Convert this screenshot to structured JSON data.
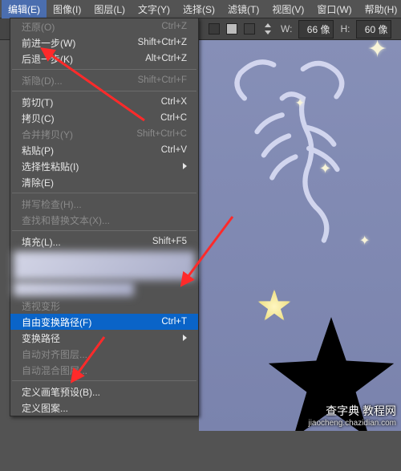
{
  "menubar": {
    "items": [
      {
        "label": "编辑(E)",
        "open": true
      },
      {
        "label": "图像(I)"
      },
      {
        "label": "图层(L)"
      },
      {
        "label": "文字(Y)"
      },
      {
        "label": "选择(S)"
      },
      {
        "label": "滤镜(T)"
      },
      {
        "label": "视图(V)"
      },
      {
        "label": "窗口(W)"
      },
      {
        "label": "帮助(H)"
      }
    ]
  },
  "edit_menu": {
    "undo": {
      "label": "还原(O)",
      "shortcut": "Ctrl+Z",
      "enabled": false
    },
    "step_fwd": {
      "label": "前进一步(W)",
      "shortcut": "Shift+Ctrl+Z",
      "enabled": true
    },
    "step_back": {
      "label": "后退一步(K)",
      "shortcut": "Alt+Ctrl+Z",
      "enabled": true
    },
    "fade": {
      "label": "渐隐(D)...",
      "shortcut": "Shift+Ctrl+F",
      "enabled": false
    },
    "cut": {
      "label": "剪切(T)",
      "shortcut": "Ctrl+X",
      "enabled": true
    },
    "copy": {
      "label": "拷贝(C)",
      "shortcut": "Ctrl+C",
      "enabled": true
    },
    "copy_merged": {
      "label": "合并拷贝(Y)",
      "shortcut": "Shift+Ctrl+C",
      "enabled": false
    },
    "paste": {
      "label": "粘贴(P)",
      "shortcut": "Ctrl+V",
      "enabled": true
    },
    "paste_sp": {
      "label": "选择性粘贴(I)",
      "shortcut": "",
      "enabled": true,
      "submenu": true
    },
    "clear": {
      "label": "清除(E)",
      "shortcut": "",
      "enabled": true
    },
    "spell": {
      "label": "拼写检查(H)...",
      "shortcut": "",
      "enabled": false
    },
    "find": {
      "label": "查找和替换文本(X)...",
      "shortcut": "",
      "enabled": false
    },
    "fill": {
      "label": "填充(L)...",
      "shortcut": "Shift+F5",
      "enabled": true
    },
    "persp": {
      "label": "透视变形",
      "shortcut": "",
      "enabled": false
    },
    "free_xform": {
      "label": "自由变换路径(F)",
      "shortcut": "Ctrl+T",
      "enabled": true,
      "highlight": true
    },
    "xform_path": {
      "label": "变换路径",
      "shortcut": "",
      "enabled": true,
      "submenu": true
    },
    "auto_align": {
      "label": "自动对齐图层...",
      "shortcut": "",
      "enabled": false
    },
    "auto_blend": {
      "label": "自动混合图层...",
      "shortcut": "",
      "enabled": false
    },
    "def_brush": {
      "label": "定义画笔预设(B)...",
      "shortcut": "",
      "enabled": true
    },
    "def_pattern": {
      "label": "定义图案...",
      "shortcut": "",
      "enabled": true
    }
  },
  "options_bar": {
    "w_label": "W:",
    "w_value": "66 像",
    "h_label": "H:",
    "h_value": "60 像"
  },
  "annotation": {
    "arrow_color": "#ff2a2a"
  },
  "watermark": {
    "line1": "查字典 教程网",
    "line2": "jiaocheng.chazidian.com"
  }
}
